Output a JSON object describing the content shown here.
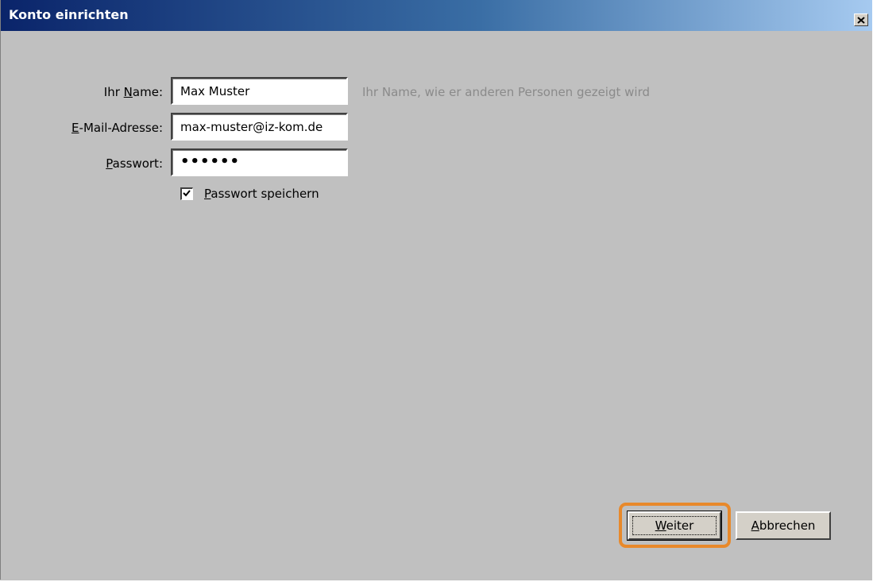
{
  "window": {
    "title": "Konto einrichten",
    "close_icon": "close-icon"
  },
  "form": {
    "name_label_pre": "Ihr ",
    "name_label_access": "N",
    "name_label_post": "ame:",
    "name_value": "Max Muster",
    "name_hint": "Ihr Name, wie er anderen Personen gezeigt wird",
    "email_label_access": "E",
    "email_label_post": "-Mail-Adresse:",
    "email_value": "max-muster@iz-kom.de",
    "password_label_access": "P",
    "password_label_post": "asswort:",
    "password_masked": "••••••",
    "save_password_access": "P",
    "save_password_post": "asswort speichern",
    "save_password_checked": true
  },
  "buttons": {
    "next_access": "W",
    "next_post": "eiter",
    "cancel_access": "A",
    "cancel_post": "bbrechen"
  },
  "colors": {
    "highlight": "#e8892b",
    "dialog_bg": "#c0c0c0",
    "title_gradient_start": "#0a246a"
  }
}
